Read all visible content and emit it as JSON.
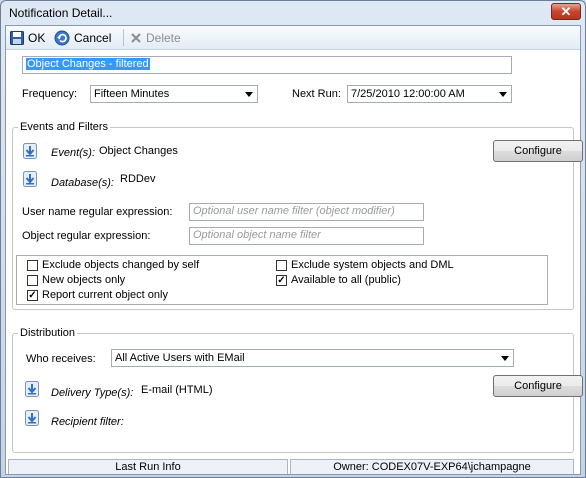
{
  "window": {
    "title": "Notification Detail...",
    "close_glyph": "✕"
  },
  "toolbar": {
    "ok_label": "OK",
    "cancel_label": "Cancel",
    "delete_label": "Delete"
  },
  "name": {
    "value": "Object Changes - filtered"
  },
  "frequency": {
    "label": "Frequency:",
    "value": "Fifteen Minutes"
  },
  "next_run": {
    "label": "Next Run:",
    "value": "7/25/2010 12:00:00 AM"
  },
  "events_group": {
    "title": "Events and Filters",
    "events_label": "Event(s):",
    "events_value": "Object Changes",
    "configure_label": "Configure",
    "database_label": "Database(s):",
    "database_value": "RDDev",
    "username_label": "User name regular expression:",
    "username_placeholder": "Optional user name filter (object modifier)",
    "object_label": "Object regular expression:",
    "object_placeholder": "Optional object name filter",
    "checkboxes": [
      {
        "label": "Exclude objects changed by self",
        "checked": false
      },
      {
        "label": "New objects only",
        "checked": false
      },
      {
        "label": "Report current object only",
        "checked": true
      },
      {
        "label": "Exclude system objects and DML",
        "checked": false
      },
      {
        "label": "Available to all (public)",
        "checked": true
      }
    ],
    "check_glyph": "✓"
  },
  "distribution": {
    "title": "Distribution",
    "receives_label": "Who receives:",
    "receives_value": "All Active Users with EMail",
    "delivery_label": "Delivery Type(s):",
    "delivery_value": "E-mail (HTML)",
    "configure_label": "Configure",
    "recipient_label": "Recipient filter:"
  },
  "status": {
    "last_run": "Last Run Info",
    "owner": "Owner:  CODEX07V-EXP64\\jchampagne"
  },
  "colors": {
    "selection": "#3399ff",
    "icon_blue": "#2f6fc4",
    "close_red": "#c8452d"
  },
  "icons": [
    "floppy-save-icon",
    "undo-cancel-icon",
    "delete-x-icon",
    "download-arrow-icon",
    "dropdown-arrow-icon"
  ]
}
